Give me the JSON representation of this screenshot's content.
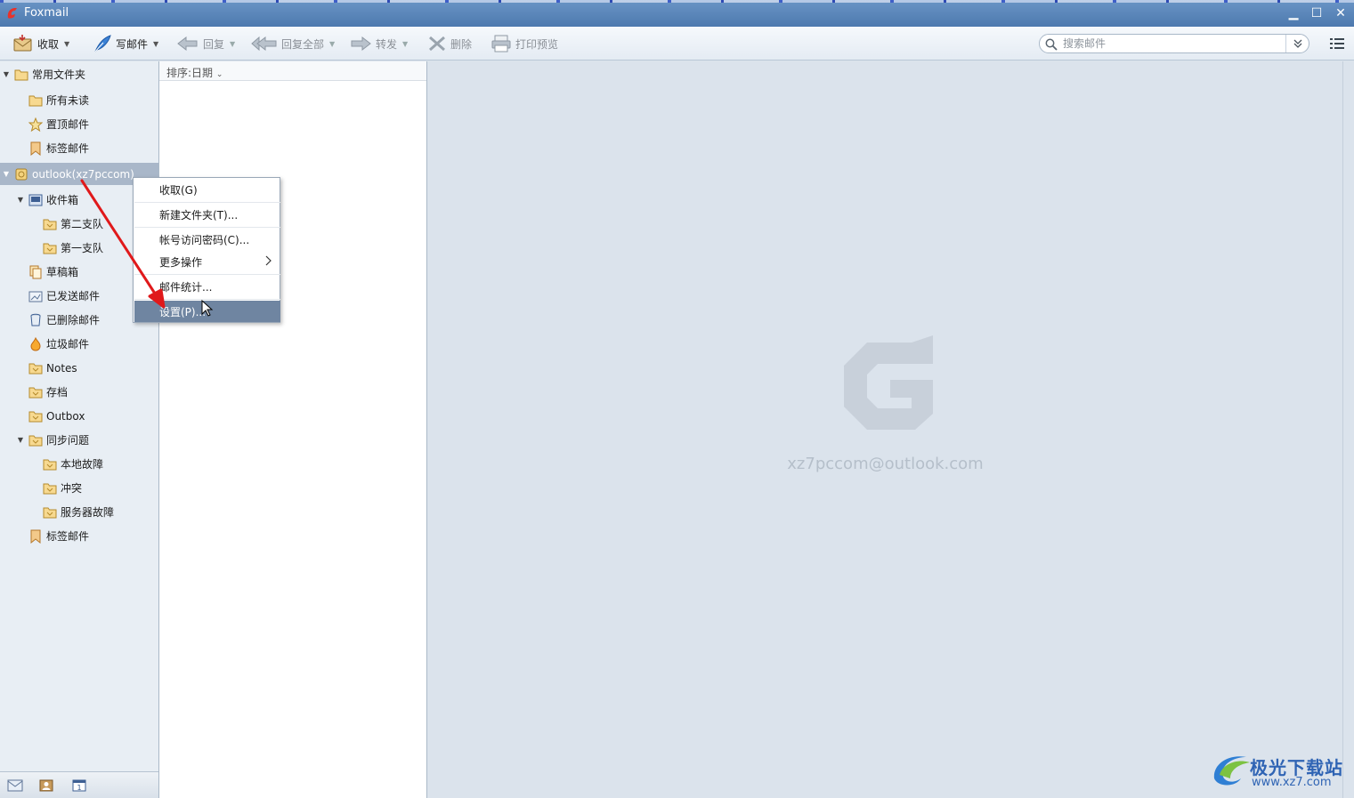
{
  "window": {
    "title": "Foxmail",
    "minimize": "▁",
    "maximize": "☐",
    "close": "✕"
  },
  "toolbar": {
    "receive": "收取",
    "compose": "写邮件",
    "reply": "回复",
    "reply_all": "回复全部",
    "forward": "转发",
    "delete": "删除",
    "print_preview": "打印预览",
    "search_placeholder": "搜索邮件"
  },
  "sidebar": {
    "favorites": {
      "label": "常用文件夹",
      "items": [
        "所有未读",
        "置顶邮件",
        "标签邮件"
      ]
    },
    "account": {
      "label": "outlook(xz7pccom)",
      "inbox": "收件箱",
      "inbox_children": [
        "第二支队",
        "第一支队"
      ],
      "folders": [
        "草稿箱",
        "已发送邮件",
        "已删除邮件",
        "垃圾邮件",
        "Notes",
        "存档",
        "Outbox"
      ],
      "sync_issues": "同步问题",
      "sync_children": [
        "本地故障",
        "冲突",
        "服务器故障"
      ],
      "tagged": "标签邮件"
    }
  },
  "mail_list": {
    "sort_label": "排序:日期"
  },
  "reading_pane": {
    "account_email": "xz7pccom@outlook.com"
  },
  "context_menu": {
    "items": [
      "收取(G)",
      "新建文件夹(T)...",
      "帐号访问密码(C)...",
      "更多操作",
      "邮件统计...",
      "设置(P)..."
    ]
  },
  "brand": {
    "name": "极光下载站",
    "url": "www.xz7.com"
  },
  "colors": {
    "titlebar": "#5a86bb",
    "selection": "#a9b7c9",
    "menu_hover": "#6f85a1",
    "annotation_arrow": "#e0191b",
    "brand": "#2f64b4"
  }
}
